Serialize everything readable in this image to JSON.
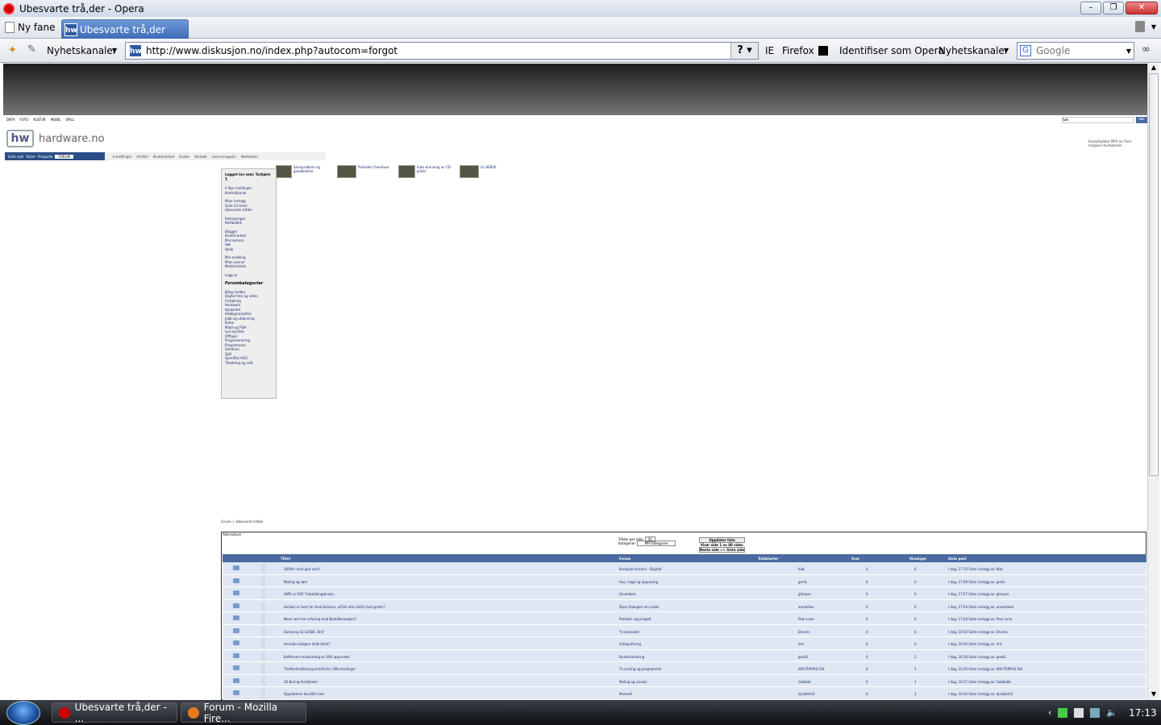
{
  "window": {
    "title": "Ubesvarte trå,der - Opera",
    "min": "–",
    "max": "❐",
    "close": "✕"
  },
  "tabs": {
    "new_tab": "Ny fane",
    "active_tab": "Ubesvarte trå,der",
    "tab_icon": "hw"
  },
  "toolbar": {
    "feeds": "Nyhetskanaler",
    "url": "http://www.diskusjon.no/index.php?autocom=forgot",
    "url_help": "?",
    "ie": "IE",
    "firefox": "Firefox",
    "identify": "Identifiser som Opera",
    "feeds2": "Nyhetskanaler",
    "search_placeholder": "Google",
    "search_logo": "G"
  },
  "site": {
    "top_links": [
      "DATA",
      "FOTO",
      "KULTUR",
      "MOBIL",
      "SPILL"
    ],
    "logo_mark": "hw",
    "logo_text": "hardware.no",
    "search_value": "Søk",
    "search_button": "Søk",
    "top_right": "Kampklubber     MPX.se  Flere magasin   Hurtiglinker",
    "nav": [
      "Siste nytt",
      "Tester",
      "Prisguide",
      "FORUM"
    ],
    "subnav": [
      "Innstillinger",
      "Artikler",
      "Bruktmarked",
      "Guider",
      "Kontakt",
      "Lesersmagazin",
      "Nettsteder"
    ]
  },
  "sidebar": {
    "header": "Logget inn som: Torbjørn T.",
    "group1": [
      "0 Nye meldinger",
      "Kontrollpanel"
    ],
    "group2": [
      "Mine innlegg",
      "Siste 24 timer",
      "Ubesvarte tråder"
    ],
    "group3": [
      "Ratings/nger",
      "Nettbutikk"
    ],
    "group4": [
      "Blogger",
      "Bruktmarked",
      "Min kamera",
      "Søk",
      "Hjelp"
    ],
    "group5": [
      "Min avdeling",
      "Mine venner",
      "Medlemsliste"
    ],
    "group6": [
      "Logg ut"
    ],
    "cat_header": "Forumkategorier",
    "categories": [
      "Bilag meldur",
      "Digital foto og video",
      "Feilsøking",
      "Hardware",
      "Hjelpefelt",
      "Hobbyprosjekter",
      "Jobb og utdanning",
      "Kultur",
      "Mobil og PDA",
      "Lyd og bilde",
      "Offtopic",
      "Programmering",
      "Programvare",
      "Samfunn",
      "Spill",
      "Spesifikk HOS",
      "Tilkobling og nett"
    ]
  },
  "thumbs": [
    "Sjeraproblem og gudsbildene",
    "Painkiller Overdose",
    "Auto-brenning av CD-plater",
    "LG KE800"
  ],
  "forum": {
    "breadcrumb": "Forum  >  Ubesvarte tråder",
    "box_label": "Alternativer",
    "per_page_label": "Tråder per side:",
    "per_page_value": "50",
    "category_label": "Kategorier:",
    "category_value": "Alle kategorier",
    "refresh": "Oppdater liste",
    "page_info": "Viser side 1 av 88 sider.",
    "next": "Neste side >>  Siste side",
    "columns": [
      "Tittel",
      "Forum",
      "Trådstarter",
      "Svar",
      "Visninger",
      "Siste post"
    ],
    "rows": [
      {
        "title": "3000hr med god oom?",
        "forum": "Kompakt kamera - Digitalt",
        "starter": "Kløs",
        "replies": "0",
        "views": "0",
        "last": "I dag, 17:10  Siste innlegg av: Kløs"
      },
      {
        "title": "Maling og søm",
        "forum": "Hus, hage og oppussing",
        "starter": "gerlis",
        "replies": "0",
        "views": "0",
        "last": "I dag, 17:09  Siste innlegg av: gerlis"
      },
      {
        "title": "AMD vs 939\" Anbefaling/ønske...",
        "forum": "Hovedkort",
        "starter": "glimpse",
        "replies": "0",
        "views": "0",
        "last": "I dag, 17:07  Siste innlegg av: glimpse"
      },
      {
        "title": "Hvilken er best for Oeal Kamera, w510i eller k810 med grafer?",
        "forum": "Âpen Dialogen om mobil",
        "starter": "ameofake",
        "replies": "0",
        "views": "0",
        "last": "I dag, 17:04  Siste innlegg av: ameofakes"
      },
      {
        "title": "Noen som har erfaring med BankNorwegian?",
        "forum": "Produkt- og prisgalt",
        "starter": "Pear Lone",
        "replies": "0",
        "views": "0",
        "last": "I dag, 17:04  Siste innlegg av: Pear Lone"
      },
      {
        "title": "Samsung LE-32S81. Bra?",
        "forum": "Tv-spesialist",
        "starter": "Drunks",
        "replies": "0",
        "views": "0",
        "last": "I dag, 16:52  Siste innlegg av: Drunks"
      },
      {
        "title": "Hvordan balgere dalle bilde?",
        "forum": "Fotografering",
        "starter": "Ims",
        "replies": "0",
        "views": "0",
        "last": "I dag, 16:40  Siste innlegg av: Ims"
      },
      {
        "title": "Kaffekvern-maskinteig en SRA apparatet",
        "forum": "Bruktmarkering",
        "starter": "geeb1",
        "replies": "0",
        "views": "2",
        "last": "I dag, 16:39  Siste innlegg av: geeb1"
      },
      {
        "title": "TheRoxheeDiskusjonstråd for USB sendinger",
        "forum": "Tv-visning og programmer",
        "starter": "666-TRIPPLE-SIX",
        "replies": "0",
        "views": "1",
        "last": "I dag, 16:39  Siste innlegg av: 666-TRIPPLE-SIX"
      },
      {
        "title": "2K Boring Ansttjenks",
        "forum": "Maling og visuals",
        "starter": "Gobbob",
        "replies": "0",
        "views": "1",
        "last": "I dag, 16:37  Siste innlegg av: Gobbobb"
      },
      {
        "title": "Oppdateres dev360 med",
        "forum": "Moneelf",
        "starter": "djrabbit33",
        "replies": "0",
        "views": "3",
        "last": "I dag, 16:34  Siste innlegg av: djrabbit33"
      }
    ]
  },
  "taskbar": {
    "task1": "Ubesvarte trå,der - ...",
    "task2": "Forum - Mozilla Fire...",
    "clock": "17:13"
  }
}
